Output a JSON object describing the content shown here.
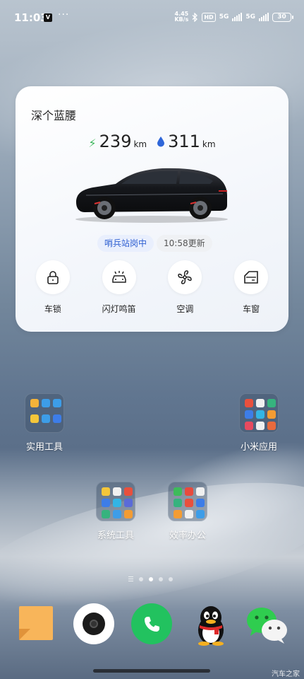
{
  "status_bar": {
    "time": "11:03",
    "notif_badge": "V",
    "more": "···",
    "net_speed_value": "4.45",
    "net_speed_unit": "KB/s",
    "hd": "HD",
    "sim1": "5G",
    "sim2": "5G",
    "battery": "30"
  },
  "car_widget": {
    "name": "深个蓝腰",
    "electric_range": "239",
    "fuel_range": "311",
    "range_unit": "km",
    "sentry_status": "哨兵站岗中",
    "update_time": "10:58更新",
    "actions": [
      {
        "label": "车锁",
        "icon": "lock-icon"
      },
      {
        "label": "闪灯鸣笛",
        "icon": "car-horn-icon"
      },
      {
        "label": "空调",
        "icon": "fan-icon"
      },
      {
        "label": "车窗",
        "icon": "car-window-icon"
      }
    ]
  },
  "folders": [
    {
      "label": "实用工具"
    },
    {
      "label": "小米应用"
    },
    {
      "label": "系统工具"
    },
    {
      "label": "效率办公"
    }
  ],
  "page_indicator": {
    "pages": 4,
    "current": 2
  },
  "dock": [
    {
      "app": "notes-icon"
    },
    {
      "app": "camera-icon"
    },
    {
      "app": "phone-icon"
    },
    {
      "app": "qq-icon"
    },
    {
      "app": "wechat-icon"
    }
  ],
  "watermark": "汽车之家",
  "colors": {
    "accent_blue": "#2e5fd1",
    "bolt_green": "#3bb55a",
    "phone_green": "#22c25f",
    "notes_orange": "#f8b55a"
  }
}
